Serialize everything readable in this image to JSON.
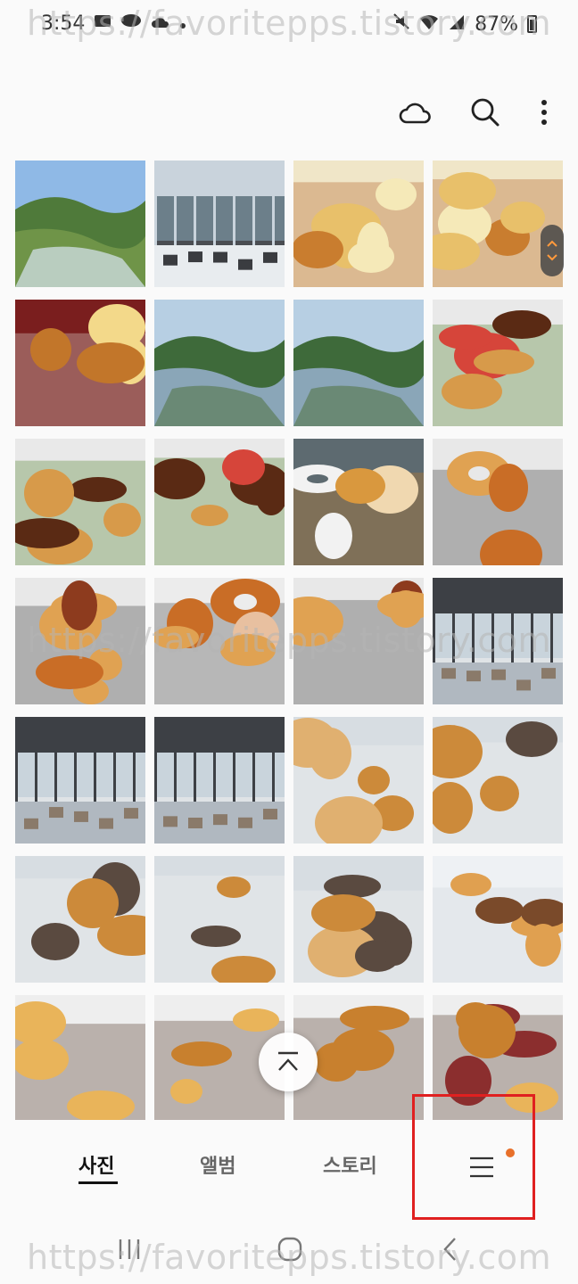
{
  "status_bar": {
    "time": "3:54",
    "battery_text": "87%",
    "icons": [
      "message-icon",
      "talk-icon",
      "cloud-icon",
      "dot-icon",
      "mute-icon",
      "wifi-icon",
      "signal-icon",
      "battery-icon"
    ]
  },
  "toolbar": {
    "icons": [
      "cloud-icon",
      "search-icon",
      "more-vertical-icon"
    ]
  },
  "gallery": {
    "photos": [
      {
        "subject": "landscape-town"
      },
      {
        "subject": "cafe-panorama-window"
      },
      {
        "subject": "pastry-pieces"
      },
      {
        "subject": "pastry-pieces"
      },
      {
        "subject": "croissant-closeup"
      },
      {
        "subject": "lake-view"
      },
      {
        "subject": "lake-view"
      },
      {
        "subject": "drinks-bread"
      },
      {
        "subject": "drinks-bread"
      },
      {
        "subject": "drinks-bread"
      },
      {
        "subject": "bagel"
      },
      {
        "subject": "bagel-bread"
      },
      {
        "subject": "bagel-bread"
      },
      {
        "subject": "bagel-hand"
      },
      {
        "subject": "bagel-bread"
      },
      {
        "subject": "cafe-interior"
      },
      {
        "subject": "cafe-interior"
      },
      {
        "subject": "cafe-interior"
      },
      {
        "subject": "bakery-display"
      },
      {
        "subject": "bakery-display"
      },
      {
        "subject": "bakery-display"
      },
      {
        "subject": "bakery-display"
      },
      {
        "subject": "bakery-display"
      },
      {
        "subject": "pretzel-tray"
      },
      {
        "subject": "bread-tray"
      },
      {
        "subject": "bread-tray"
      },
      {
        "subject": "bread-tray"
      },
      {
        "subject": "bread-tray"
      }
    ],
    "scroll_to_top_icon": "chevron-up-icon"
  },
  "bottom_nav": {
    "tabs": [
      {
        "label": "사진",
        "active": true
      },
      {
        "label": "앨범",
        "active": false
      },
      {
        "label": "스토리",
        "active": false
      }
    ],
    "menu_icon": "hamburger-icon",
    "badge_color": "#e8702a",
    "highlight_color": "#e02020"
  },
  "system_nav": {
    "icons": [
      "recents-icon",
      "home-icon",
      "back-icon"
    ]
  },
  "watermark": {
    "text": "https://favoritepps.tistory.com"
  }
}
